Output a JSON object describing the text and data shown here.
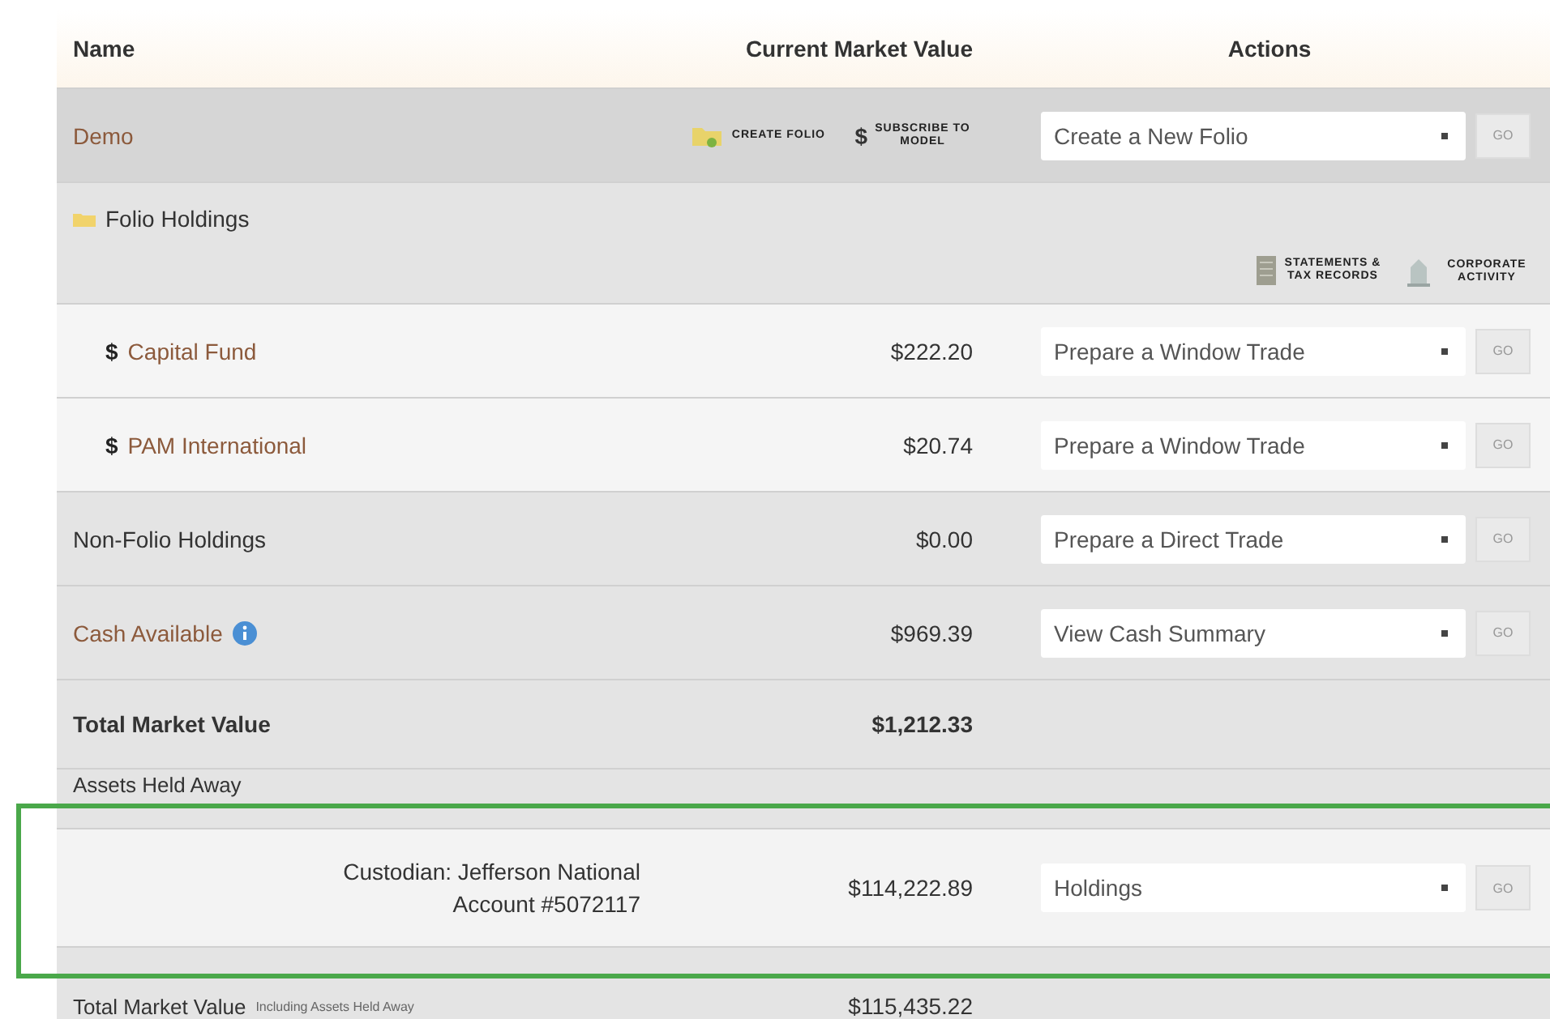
{
  "columns": [
    "Name",
    "Current Market Value",
    "Actions"
  ],
  "rows": [
    {
      "kind": "account",
      "name": "Demo",
      "tools": [
        {
          "kind": "folder",
          "label": "CREATE FOLIO"
        },
        {
          "kind": "dollar",
          "symbol": "$",
          "label": "SUBSCRIBE TO MODEL"
        }
      ],
      "action": "Create a New Folio",
      "go": "GO"
    },
    {
      "kind": "section",
      "name": "Folio Holdings",
      "tools": [
        {
          "kind": "document",
          "label": "STATEMENTS & TAX RECORDS"
        },
        {
          "kind": "building",
          "label": "CORPORATE ACTIVITY"
        }
      ]
    },
    {
      "kind": "fund",
      "symbol": "$",
      "name": "Capital Fund",
      "value": "$222.20",
      "action": "Prepare a Window Trade",
      "go": "GO"
    },
    {
      "kind": "fund",
      "symbol": "$",
      "name": "PAM International",
      "value": "$20.74",
      "action": "Prepare a Window Trade",
      "go": "GO"
    },
    {
      "kind": "plain",
      "name": "Non-Folio Holdings",
      "value": "$0.00",
      "action": "Prepare a Direct Trade",
      "go": "GO"
    },
    {
      "kind": "cash",
      "name": "Cash Available",
      "value": "$969.39",
      "action": "View Cash Summary",
      "go": "GO"
    },
    {
      "kind": "total",
      "name": "Total Market Value",
      "value": "$1,212.33"
    },
    {
      "kind": "subheader",
      "name": "Assets Held Away"
    },
    {
      "kind": "custodian",
      "name": "Custodian: Jefferson National",
      "account": "Account #5072117",
      "value": "$114,222.89",
      "action": "Holdings",
      "go": "GO",
      "highlighted": true
    },
    {
      "kind": "grand_total",
      "name": "Total Market Value",
      "note": "Including Assets Held Away",
      "value": "$115,435.22"
    }
  ]
}
